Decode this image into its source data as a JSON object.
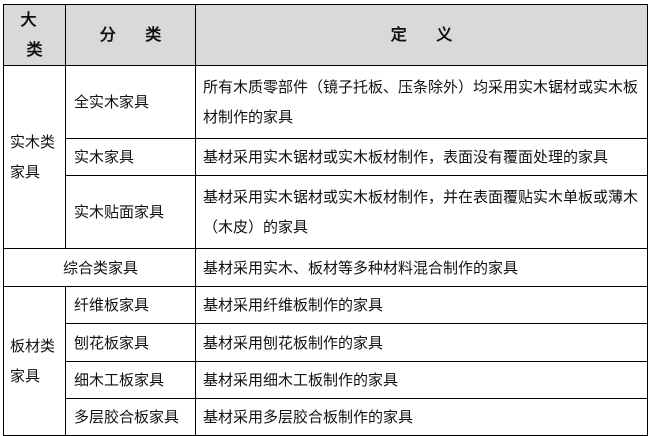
{
  "header": {
    "major": "大 类",
    "sub": "分 类",
    "definition": "定 义"
  },
  "groups": {
    "solid": {
      "label": "实木类家具",
      "rows": [
        {
          "sub": "全实木家具",
          "def": "所有木质零部件（镜子托板、压条除外）均采用实木锯材或实木板材制作的家具"
        },
        {
          "sub": "实木家具",
          "def": "基材采用实木锯材或实木板材制作，表面没有覆面处理的家具"
        },
        {
          "sub": "实木贴面家具",
          "def": "基材采用实木锯材或实木板材制作，并在表面覆贴实木单板或薄木（木皮）的家具"
        }
      ]
    },
    "composite": {
      "label": "综合类家具",
      "def": "基材采用实木、板材等多种材料混合制作的家具"
    },
    "board": {
      "label": "板材类家具",
      "rows": [
        {
          "sub": "纤维板家具",
          "def": "基材采用纤维板制作的家具"
        },
        {
          "sub": "刨花板家具",
          "def": "基材采用刨花板制作的家具"
        },
        {
          "sub": "细木工板家具",
          "def": "基材采用细木工板制作的家具"
        },
        {
          "sub": "多层胶合板家具",
          "def": "基材采用多层胶合板制作的家具"
        }
      ]
    }
  }
}
